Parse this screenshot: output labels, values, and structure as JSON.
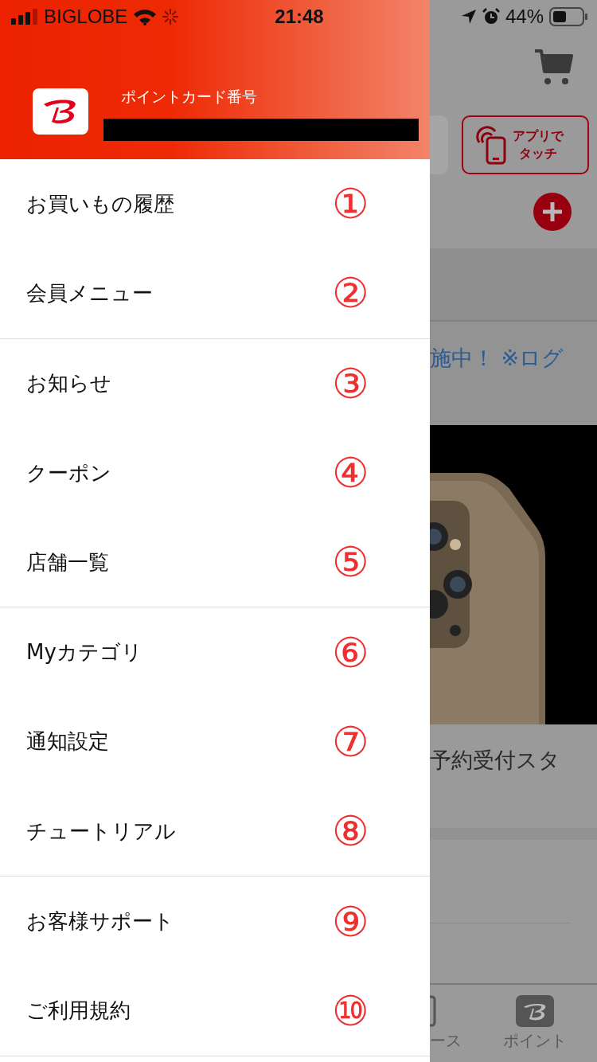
{
  "status_bar": {
    "carrier": "BIGLOBE",
    "time": "21:48",
    "battery": "44%"
  },
  "drawer": {
    "card_label": "ポイントカード番号",
    "groups": [
      {
        "items": [
          {
            "label": "お買いもの履歴",
            "marker": "①"
          },
          {
            "label": "会員メニュー",
            "marker": "②"
          }
        ]
      },
      {
        "items": [
          {
            "label": "お知らせ",
            "marker": "③"
          },
          {
            "label": "クーポン",
            "marker": "④"
          },
          {
            "label": "店舗一覧",
            "marker": "⑤"
          }
        ]
      },
      {
        "items": [
          {
            "label": "Myカテゴリ",
            "marker": "⑥"
          },
          {
            "label": "通知設定",
            "marker": "⑦"
          },
          {
            "label": "チュートリアル",
            "marker": "⑧"
          }
        ]
      },
      {
        "items": [
          {
            "label": "お客様サポート",
            "marker": "⑨"
          },
          {
            "label": "ご利用規約",
            "marker": "⑩"
          }
        ]
      }
    ]
  },
  "background_page": {
    "touch_button": [
      "アプリで",
      "タッチ"
    ],
    "banner_text": "施中！ ※ログ",
    "news_text": "予約受付スタ",
    "tabs": [
      {
        "label": "ース"
      },
      {
        "label": "ポイント"
      }
    ]
  }
}
